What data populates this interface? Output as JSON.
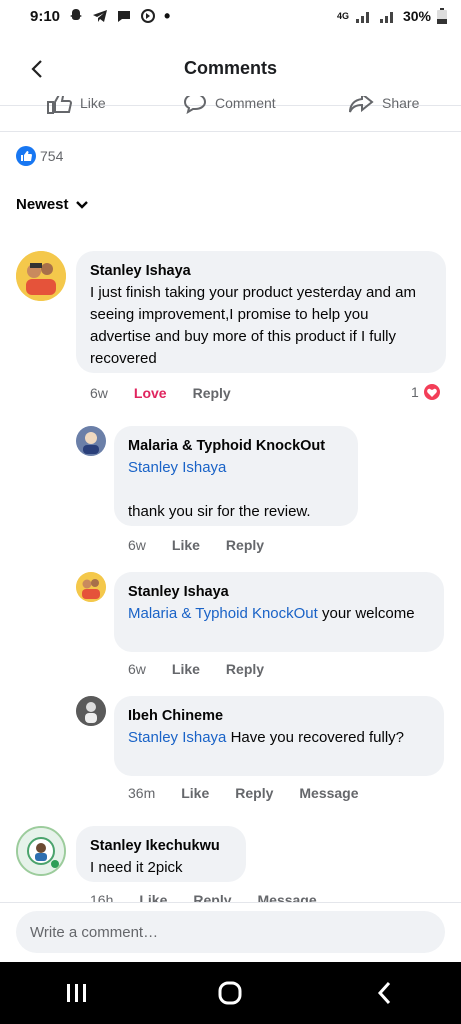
{
  "status_bar": {
    "time": "9:10",
    "network": "4G",
    "battery": "30%"
  },
  "header": {
    "title": "Comments"
  },
  "actions": {
    "like": "Like",
    "comment": "Comment",
    "share": "Share"
  },
  "reactions": {
    "count": "754"
  },
  "sort": {
    "label": "Newest"
  },
  "comments": [
    {
      "author": "Stanley Ishaya",
      "text": "I just finish taking your product yesterday and am seeing improvement,I promise to help you advertise and buy more of  this product if I fully recovered",
      "time": "6w",
      "reaction": "Love",
      "reply": "Reply",
      "react_count": "1",
      "replies": [
        {
          "author": "Malaria & Typhoid KnockOut",
          "mention": "Stanley Ishaya",
          "text": "thank you sir for the review.",
          "time": "6w",
          "like": "Like",
          "reply": "Reply"
        },
        {
          "author": "Stanley Ishaya",
          "mention": "Malaria & Typhoid KnockOut",
          "text": " your welcome",
          "time": "6w",
          "like": "Like",
          "reply": "Reply"
        },
        {
          "author": "Ibeh Chineme",
          "mention": "Stanley Ishaya",
          "text": " Have you recovered fully?",
          "time": "36m",
          "like": "Like",
          "reply": "Reply",
          "message": "Message"
        }
      ]
    },
    {
      "author": "Stanley Ikechukwu",
      "text": "I need it 2pick",
      "time": "16h",
      "like": "Like",
      "reply": "Reply",
      "message": "Message"
    }
  ],
  "composer": {
    "placeholder": "Write a comment…"
  },
  "colors": {
    "accent": "#1877f2",
    "mention": "#1a63c7",
    "love": "#e0245e",
    "bubble": "#f0f2f5"
  }
}
